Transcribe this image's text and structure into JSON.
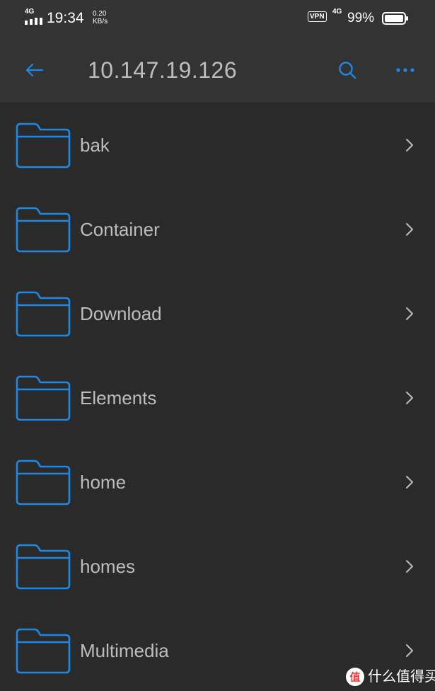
{
  "status_bar": {
    "network_type": "4G",
    "time": "19:34",
    "speed_value": "0.20",
    "speed_unit": "KB/s",
    "vpn_label": "VPN",
    "network_type_2": "4G",
    "battery_percent": "99%"
  },
  "app_bar": {
    "title": "10.147.19.126",
    "back_icon": "arrow-left-icon",
    "search_icon": "search-icon",
    "more_icon": "more-horizontal-icon"
  },
  "folders": [
    {
      "label": "bak"
    },
    {
      "label": "Container"
    },
    {
      "label": "Download"
    },
    {
      "label": "Elements"
    },
    {
      "label": "home"
    },
    {
      "label": "homes"
    },
    {
      "label": "Multimedia"
    }
  ],
  "watermark": {
    "text": "什么值得买",
    "logo_glyph": "值"
  },
  "colors": {
    "accent": "#1e88e5",
    "background": "#2a2a2a",
    "header": "#333333",
    "text": "#bdbdbd"
  }
}
